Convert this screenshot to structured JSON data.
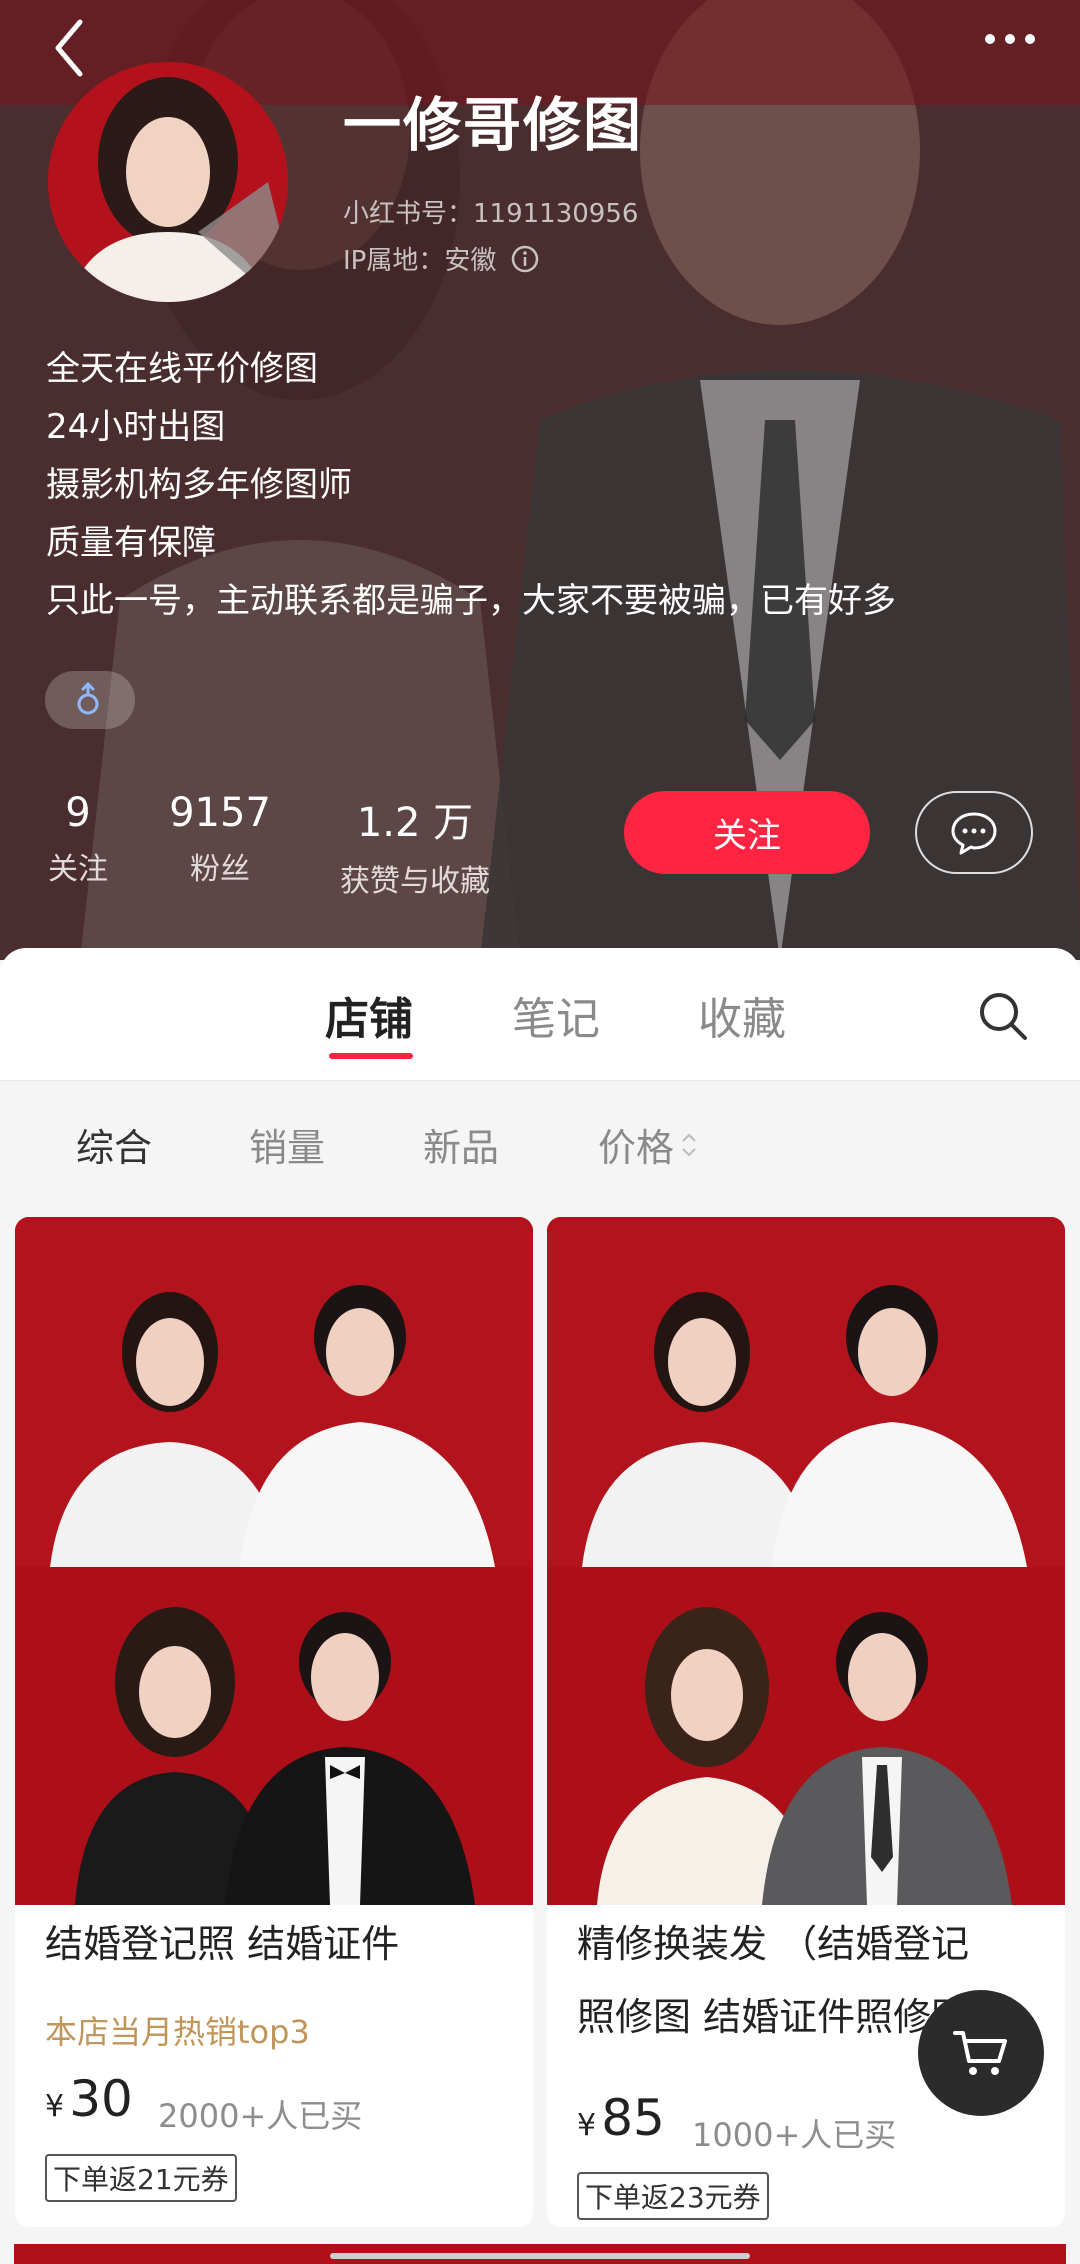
{
  "header": {
    "name": "一修哥修图",
    "id_text": "小红书号：1191130956",
    "ip_text": "IP属地：安徽"
  },
  "bio": [
    "全天在线平价修图",
    "24小时出图",
    "摄影机构多年修图师",
    "质量有保障",
    "只此一号，主动联系都是骗子，大家不要被骗，已有好多"
  ],
  "stats": [
    {
      "num": "9",
      "label": "关注"
    },
    {
      "num": "9157",
      "label": "粉丝"
    },
    {
      "num": "1.2 万",
      "label": "获赞与收藏"
    }
  ],
  "actions": {
    "follow_label": "关注"
  },
  "tabs": [
    {
      "label": "店铺",
      "active": true
    },
    {
      "label": "笔记",
      "active": false
    },
    {
      "label": "收藏",
      "active": false
    }
  ],
  "sort": [
    {
      "label": "综合",
      "active": true
    },
    {
      "label": "销量",
      "active": false
    },
    {
      "label": "新品",
      "active": false
    },
    {
      "label": "价格",
      "active": false
    }
  ],
  "products": [
    {
      "title": "结婚登记照 结婚证件",
      "tag": "本店当月热销top3",
      "currency": "¥",
      "price": "30",
      "sold": "2000+人已买",
      "coupon": "下单返21元券"
    },
    {
      "title_line1": "精修换装发 （结婚登记",
      "title_line2": "照修图 结婚证件照修图",
      "currency": "¥",
      "price": "85",
      "sold": "1000+人已买",
      "coupon": "下单返23元券"
    }
  ],
  "colors": {
    "accent": "#ff2442",
    "tag_gold": "#c0955a",
    "photo_red": "#b0101a"
  },
  "icons": [
    "back-arrow-icon",
    "more-dots-icon",
    "info-icon",
    "gender-male-icon",
    "chat-icon",
    "search-icon",
    "sort-arrows-icon",
    "cart-icon"
  ]
}
